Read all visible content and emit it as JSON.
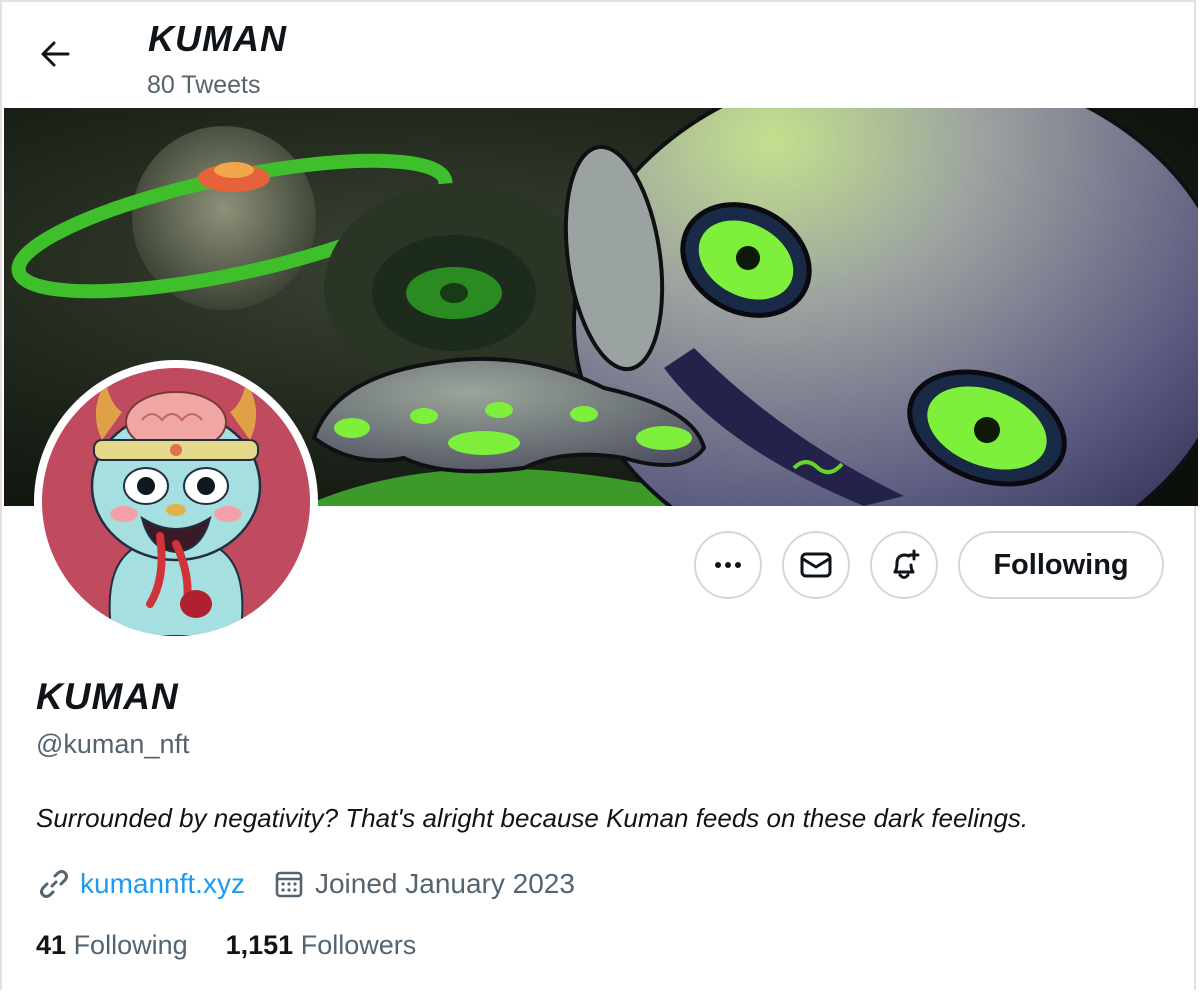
{
  "header": {
    "name": "KUMAN",
    "tweet_count": "80 Tweets"
  },
  "profile": {
    "display_name": "KUMAN",
    "handle": "@kuman_nft",
    "bio": "Surrounded by negativity? That's alright because Kuman feeds on these dark feelings.",
    "website": "kumannft.xyz",
    "joined": "Joined January 2023"
  },
  "actions": {
    "more_icon": "more-horizontal-icon",
    "message_icon": "envelope-icon",
    "notify_icon": "bell-plus-icon",
    "following_label": "Following"
  },
  "stats": {
    "following_count": "41",
    "following_label": "Following",
    "followers_count": "1,151",
    "followers_label": "Followers"
  },
  "colors": {
    "link": "#1d9bf0",
    "secondary_text": "#536471",
    "primary_text": "#0f1419",
    "button_border": "#cfd9de"
  }
}
